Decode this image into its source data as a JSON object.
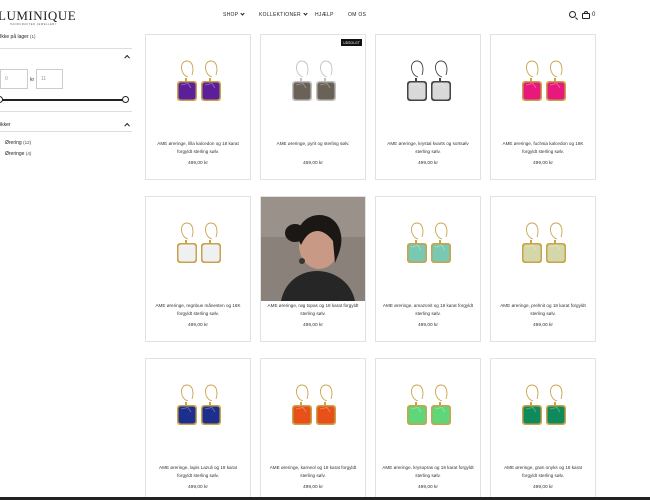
{
  "header": {
    "logo_text": "LUMINIQUE",
    "logo_tagline": "HANDCRAFTED JEWELLERY",
    "nav": [
      {
        "label": "SHOP",
        "has_dropdown": true
      },
      {
        "label": "KOLLEKTIONER",
        "has_dropdown": true
      },
      {
        "label": "HJÆLP",
        "has_dropdown": false
      },
      {
        "label": "OM OS",
        "has_dropdown": false
      }
    ],
    "cart_count": "0",
    "icons": [
      "search-icon",
      "cart-icon"
    ]
  },
  "filters": {
    "stock": {
      "label": "Ikke på lager",
      "count": "(1)"
    },
    "price": {
      "from_placeholder": "0",
      "to_placeholder": "11",
      "separator": "kr"
    },
    "type_heading": "ikker",
    "types": [
      {
        "label": "Ørering",
        "count": "(12)"
      },
      {
        "label": "Øreringe",
        "count": "(4)"
      }
    ]
  },
  "products": [
    {
      "title": "AME øreringe, lilla kalcedon og 18 karat forgyldt sterling sølv.",
      "price": "499,00 kr",
      "stone_color": "#5b1f9a",
      "metal": "gold"
    },
    {
      "title": "AME øreringe, pyrit og sterling sølv.",
      "price": "469,00 kr",
      "stone_color": "#6a6157",
      "metal": "silver",
      "badge": "UDSOLGT"
    },
    {
      "title": "AME øreringe, krystal kvarts og sortsølv sterling sølv.",
      "price": "499,00 kr",
      "stone_color": "#d9d9d9",
      "metal": "black"
    },
    {
      "title": "AME øreringe, fuchsia kalcedon og 18K forgyldt sterling sølv.",
      "price": "499,00 kr",
      "stone_color": "#e8197d",
      "metal": "gold"
    },
    {
      "title": "AME øreringe, regnbue månesten og 18K forgyldt sterling sølv.",
      "price": "499,00 kr",
      "stone_color": "#eef0f2",
      "metal": "gold"
    },
    {
      "title": "AME øreringe, røg topas og 18 karat forgyldt sterling sølv.",
      "price": "499,00 kr",
      "photo": true
    },
    {
      "title": "AME øreringe, amazonit og 18 karat forgyldt sterling sølv.",
      "price": "499,00 kr",
      "stone_color": "#79c9b2",
      "metal": "gold"
    },
    {
      "title": "AME øreringe, prehnit og 18 karat forgyldt sterling sølv.",
      "price": "499,00 kr",
      "stone_color": "#d4d7a8",
      "metal": "gold"
    },
    {
      "title": "AME øreringe, lapis Lazuli og 18 karat forgyldt sterling sølv.",
      "price": "499,00 kr",
      "stone_color": "#1d2f8c",
      "metal": "gold"
    },
    {
      "title": "AME øreringe, karneol og 18 karat forgyldt sterling sølv.",
      "price": "499,00 kr",
      "stone_color": "#e8501a",
      "metal": "gold"
    },
    {
      "title": "AME øreringe, krysopras og 18 karat forgyldt sterling sølv.",
      "price": "499,00 kr",
      "stone_color": "#5fd678",
      "metal": "gold"
    },
    {
      "title": "AME øreringe, grøn onyks og 18 karat forgyldt sterling sølv.",
      "price": "499,00 kr",
      "stone_color": "#0f8a5a",
      "metal": "gold"
    }
  ]
}
